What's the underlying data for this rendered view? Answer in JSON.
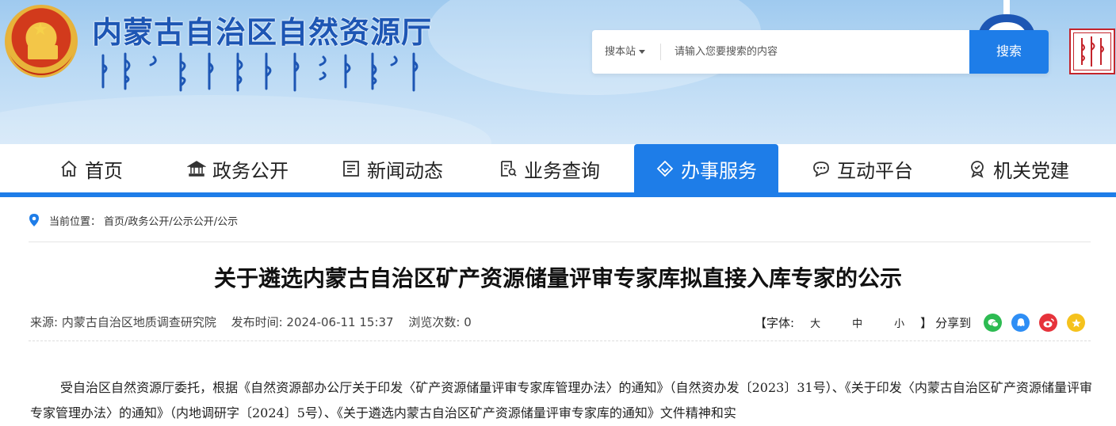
{
  "header": {
    "site_title": "内蒙古自治区自然资源厅",
    "mongolian_title": "ᠥᠪᠥᠷ ᠮᠣᠩᠭᠣᠯ ᠤᠨ ᠪᠠᠶᠢᠭᠠᠯᠢ ᠶᠢᠨ ᠨᠥᠭᠡᠴᠡ",
    "search": {
      "scope_label": "搜本站",
      "placeholder": "请输入您要搜索的内容",
      "button_label": "搜索"
    }
  },
  "nav": {
    "items": [
      {
        "label": "首页",
        "icon": "home-icon"
      },
      {
        "label": "政务公开",
        "icon": "government-building-icon"
      },
      {
        "label": "新闻动态",
        "icon": "newspaper-icon"
      },
      {
        "label": "业务查询",
        "icon": "document-search-icon"
      },
      {
        "label": "办事服务",
        "icon": "service-diamond-icon",
        "active": true
      },
      {
        "label": "互动平台",
        "icon": "chat-bubble-icon"
      },
      {
        "label": "机关党建",
        "icon": "party-badge-icon"
      }
    ]
  },
  "breadcrumb": {
    "label": "当前位置：",
    "path": "首页/政务公开/公示公开/公示"
  },
  "article": {
    "title": "关于遴选内蒙古自治区矿产资源储量评审专家库拟直接入库专家的公示",
    "meta": {
      "source": "来源:  内蒙古自治区地质调查研究院",
      "published": "发布时间:  2024-06-11 15:37",
      "views": "浏览次数:  0"
    },
    "font_size": {
      "label": "【字体:",
      "large": "大",
      "medium": "中",
      "small": "小",
      "close": "】"
    },
    "share_label": "分享到",
    "body": "受自治区自然资源厅委托，根据《自然资源部办公厅关于印发〈矿产资源储量评审专家库管理办法〉的通知》（自然资办发〔2023〕31号）、《关于印发〈内蒙古自治区矿产资源储量评审专家管理办法〉的通知》（内地调研字〔2024〕5号）、《关于遴选内蒙古自治区矿产资源储量评审专家库的通知》文件精神和实"
  },
  "colors": {
    "brand_blue": "#1e7de8",
    "title_blue": "#1d56b4",
    "wechat_green": "#2dbb52",
    "qq_blue": "#2e8ef5",
    "weibo_red": "#e6333b",
    "qzone_yellow": "#f5c21d"
  }
}
